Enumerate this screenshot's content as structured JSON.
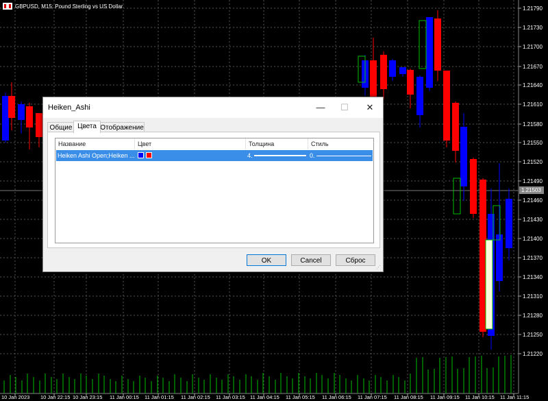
{
  "chart": {
    "symbol_title": "GBPUSD, M15:  Pound Sterling vs US Dollar",
    "current_price": "1.21503",
    "y_labels": [
      "1.21790",
      "1.21730",
      "1.21700",
      "1.21670",
      "1.21640",
      "1.21610",
      "1.21580",
      "1.21550",
      "1.21520",
      "1.21490",
      "1.21460",
      "1.21430",
      "1.21400",
      "1.21370",
      "1.21340",
      "1.21310",
      "1.21280",
      "1.21250",
      "1.21220"
    ],
    "x_labels": [
      "10 Jan 2023",
      "10 Jan 22:15",
      "10 Jan 23:15",
      "11 Jan 00:15",
      "11 Jan 01:15",
      "11 Jan 02:15",
      "11 Jan 03:15",
      "11 Jan 04:15",
      "11 Jan 05:15",
      "11 Jan 06:15",
      "11 Jan 07:15",
      "11 Jan 08:15",
      "11 Jan 09:15",
      "11 Jan 10:15",
      "11 Jan 11:15"
    ],
    "colors": {
      "bull": "#0000ff",
      "bear": "#ff0000",
      "bull_outline": "#00c000",
      "bear_fill": "#ffffe0",
      "grid": "#555555",
      "volume": "#00c000"
    }
  },
  "dialog": {
    "title": "Heiken_Ashi",
    "minimize": "—",
    "maximize": "☐",
    "close": "✕",
    "tabs": [
      "Общие",
      "Цвета",
      "Отображение"
    ],
    "active_tab": "Цвета",
    "columns": [
      "Название",
      "Цвет",
      "Толщина",
      "Стиль"
    ],
    "row": {
      "name": "Heiken Ashi Open;Heiken ...",
      "color1": "#0000ff",
      "color2": "#ff0000",
      "thickness": "4.",
      "style": "0."
    },
    "buttons": {
      "ok": "OK",
      "cancel": "Cancel",
      "reset": "Сброс"
    }
  }
}
